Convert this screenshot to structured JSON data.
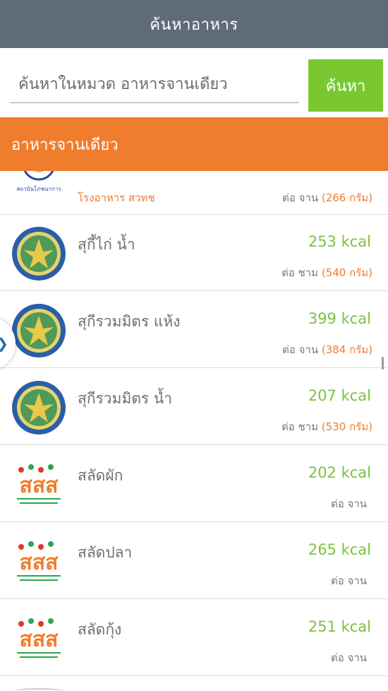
{
  "header": {
    "title": "ค้นหาอาหาร"
  },
  "search": {
    "placeholder": "ค้นหาในหมวด อาหารจานเดียว",
    "button_label": "ค้นหา"
  },
  "category": {
    "title": "อาหารจานเดียว"
  },
  "colors": {
    "header_bg": "#5f6b79",
    "button_green": "#79c832",
    "accent_orange": "#ef7d2d",
    "kcal_green": "#7cc242"
  },
  "items": [
    {
      "source": "โรงอาหาร สวทช",
      "kcal": "",
      "per": "ต่อ จาน",
      "grams": "(266 กรัม)",
      "logo": "institute-seal-icon"
    },
    {
      "name": "สุกี้ไก่ น้ำ",
      "kcal": "253 kcal",
      "per": "ต่อ ชาม",
      "grams": "(540 กรัม)",
      "logo": "health-department-emblem-icon"
    },
    {
      "name": "สุกีรวมมิตร แห้ง",
      "kcal": "399 kcal",
      "per": "ต่อ จาน",
      "grams": "(384 กรัม)",
      "logo": "health-department-emblem-icon"
    },
    {
      "name": "สุกีรวมมิตร น้ำ",
      "kcal": "207 kcal",
      "per": "ต่อ ชาม",
      "grams": "(530 กรัม)",
      "logo": "health-department-emblem-icon"
    },
    {
      "name": "สลัดผัก",
      "kcal": "202 kcal",
      "per": "ต่อ จาน",
      "grams": "",
      "logo": "thaihealth-logo-icon"
    },
    {
      "name": "สลัดปลา",
      "kcal": "265 kcal",
      "per": "ต่อ จาน",
      "grams": "",
      "logo": "thaihealth-logo-icon"
    },
    {
      "name": "สลัดกุ้ง",
      "kcal": "251 kcal",
      "per": "ต่อ จาน",
      "grams": "",
      "logo": "thaihealth-logo-icon"
    }
  ]
}
